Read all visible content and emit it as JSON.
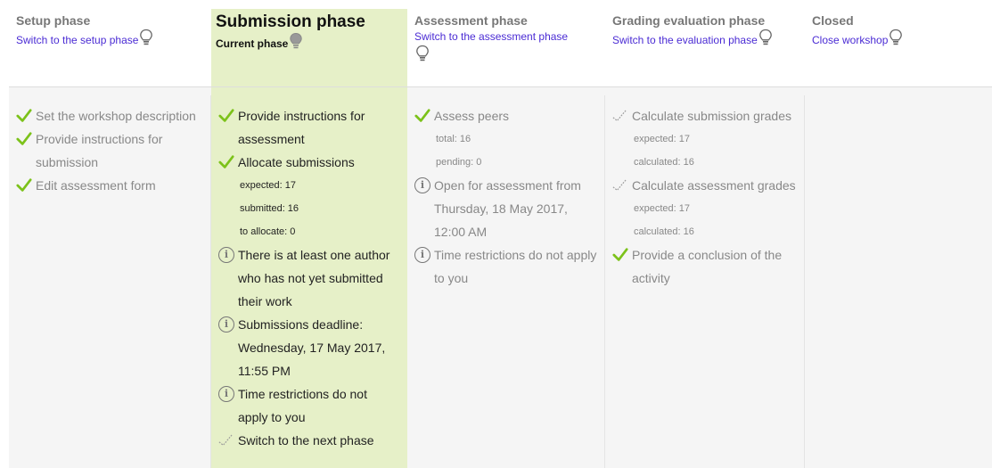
{
  "phases": [
    {
      "title": "Setup phase",
      "link": "Switch to the setup phase"
    },
    {
      "title": "Submission phase",
      "current": "Current phase"
    },
    {
      "title": "Assessment phase",
      "link": "Switch to the assessment phase"
    },
    {
      "title": "Grading evaluation phase",
      "link": "Switch to the evaluation phase"
    },
    {
      "title": "Closed",
      "link": "Close workshop"
    }
  ],
  "setup_tasks": [
    "Set the workshop description",
    "Provide instructions for submission",
    "Edit assessment form"
  ],
  "submission": {
    "task1": "Provide instructions for assessment",
    "task2": "Allocate submissions",
    "expected": "expected: 17",
    "submitted": "submitted: 16",
    "to_allocate": "to allocate: 0",
    "info1": "There is at least one author who has not yet submitted their work",
    "info2": "Submissions deadline: Wednesday, 17 May 2017, 11:55 PM",
    "info3": "Time restrictions do not apply to you",
    "next": "Switch to the next phase"
  },
  "assessment": {
    "task1": "Assess peers",
    "total": "total: 16",
    "pending": "pending: 0",
    "info1": "Open for assessment from Thursday, 18 May 2017, 12:00 AM",
    "info2": "Time restrictions do not apply to you"
  },
  "grading": {
    "task1": "Calculate submission grades",
    "expected1": "expected: 17",
    "calculated1": "calculated: 16",
    "task2": "Calculate assessment grades",
    "expected2": "expected: 17",
    "calculated2": "calculated: 16",
    "task3": "Provide a conclusion of the activity"
  },
  "colors": {
    "accent": "#4a2bd4",
    "active_bg": "#e6f0c8",
    "check": "#7cc21a"
  }
}
